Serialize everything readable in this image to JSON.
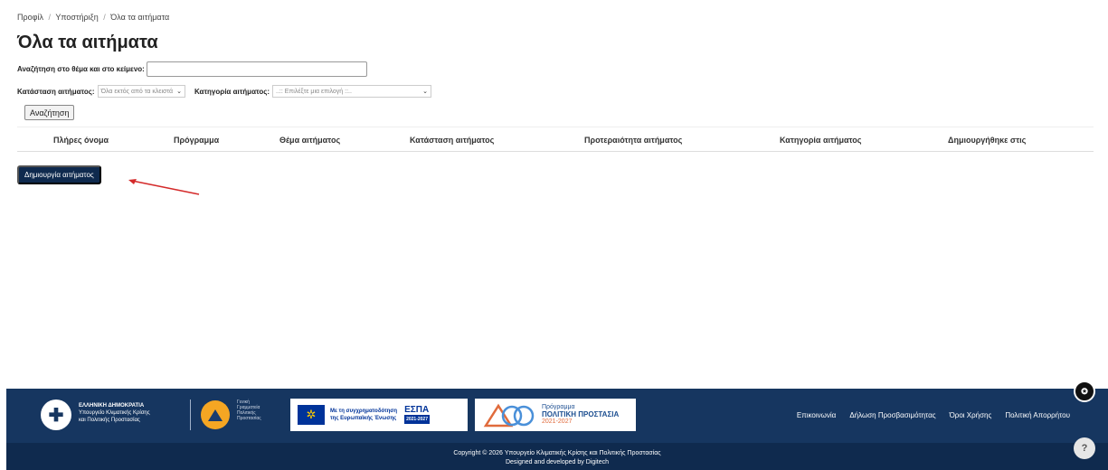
{
  "breadcrumb": {
    "items": [
      "Προφίλ",
      "Υποστήριξη",
      "Όλα τα αιτήματα"
    ],
    "separator": "/"
  },
  "page_title": "Όλα τα αιτήματα",
  "search": {
    "label": "Αναζήτηση στο θέμα και στο κείμενο:",
    "value": "",
    "button_label": "Αναζήτηση"
  },
  "filters": {
    "status_label": "Κατάσταση αιτήματος:",
    "status_value": "Όλα εκτός από τα κλειστά",
    "category_label": "Κατηγορία αιτήματος:",
    "category_value": "..:: Επιλέξτε μια επιλογή ::.."
  },
  "table": {
    "columns": [
      "Πλήρες όνομα",
      "Πρόγραμμα",
      "Θέμα αιτήματος",
      "Κατάσταση αιτήματος",
      "Προτεραιότητα αιτήματος",
      "Κατηγορία αιτήματος",
      "Δημιουργήθηκε στις"
    ]
  },
  "create_button_label": "Δημιουργία αιτήματος",
  "footer": {
    "gov": {
      "line1": "ΕΛΛΗΝΙΚΗ ΔΗΜΟΚΡΑΤΙΑ",
      "line2": "Υπουργείο Κλιματικής Κρίσης",
      "line3": "και Πολιτικής Προστασίας"
    },
    "civil_protection": {
      "line1": "Γενική",
      "line2": "Γραμματεία",
      "line3": "Πολιτικής",
      "line4": "Προστασίας"
    },
    "eu": {
      "line1": "Με τη συγχρηματοδότηση",
      "line2": "της Ευρωπαϊκής Ένωσης",
      "espa": "ΕΣΠΑ",
      "espa_years": "2021-2027"
    },
    "program": {
      "line1": "Πρόγραμμα",
      "line2": "ΠΟΛΙΤΙΚΗ ΠΡΟΣΤΑΣΙΑ",
      "line3": "2021-2027"
    },
    "links": [
      "Επικοινωνία",
      "Δήλωση Προσβασιμότητας",
      "Όροι Χρήσης",
      "Πολιτική Απορρήτου"
    ],
    "copyright": "Copyright © 2026 Υπουργείο Κλιματικής Κρίσης και Πολιτικής Προστασίας",
    "developer": "Designed and developed by Digitech"
  },
  "colors": {
    "footer_top": "#163660",
    "footer_bottom": "#0f2a4e",
    "primary_button": "#0f2a4e",
    "annotation_arrow": "#d42a2a"
  }
}
